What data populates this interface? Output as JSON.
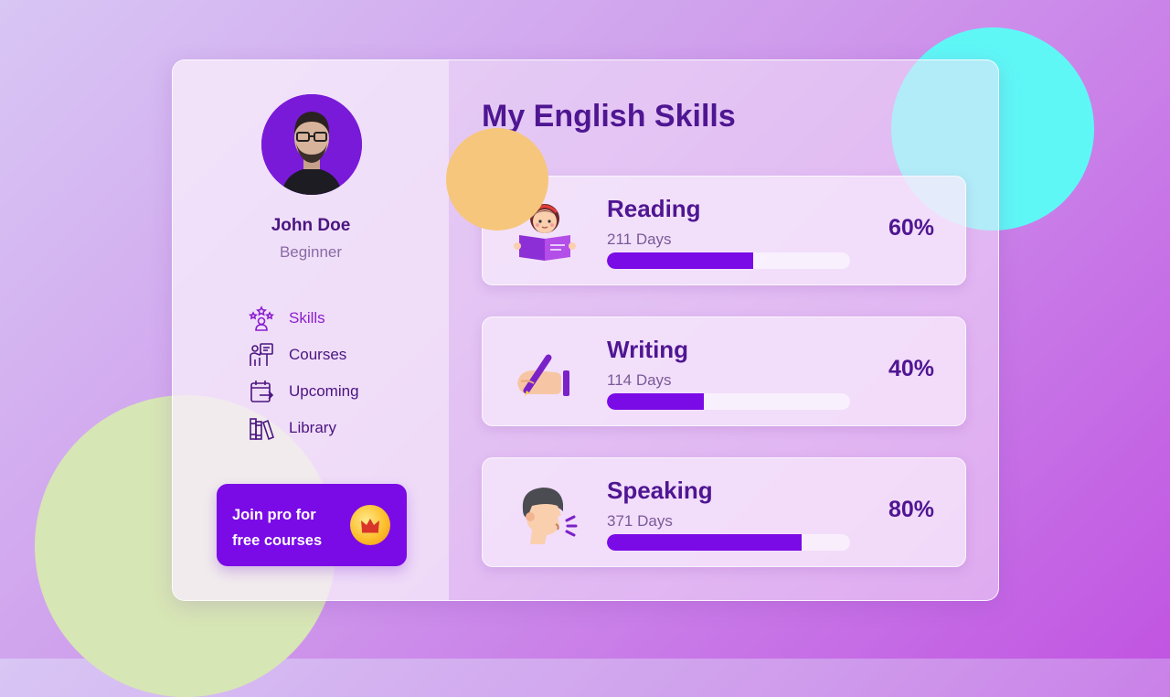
{
  "profile": {
    "name": "John Doe",
    "level": "Beginner"
  },
  "nav": [
    {
      "label": "Skills",
      "icon": "skills-icon",
      "active": true
    },
    {
      "label": "Courses",
      "icon": "courses-icon",
      "active": false
    },
    {
      "label": "Upcoming",
      "icon": "upcoming-icon",
      "active": false
    },
    {
      "label": "Library",
      "icon": "library-icon",
      "active": false
    }
  ],
  "promo": {
    "line1": "Join pro for",
    "line2": "free courses",
    "icon": "crown-icon"
  },
  "main": {
    "title": "My English Skills"
  },
  "skills": [
    {
      "name": "Reading",
      "days": "211 Days",
      "percent_text": "60%",
      "progress": 0.6,
      "icon": "reading-icon"
    },
    {
      "name": "Writing",
      "days": "114 Days",
      "percent_text": "40%",
      "progress": 0.4,
      "icon": "writing-icon"
    },
    {
      "name": "Speaking",
      "days": "371 Days",
      "percent_text": "80%",
      "progress": 0.8,
      "icon": "speaking-icon"
    }
  ],
  "colors": {
    "accent": "#7a0ae6",
    "title": "#4f1692",
    "active_nav": "#8b1fd0",
    "blob_cyan": "#5ff7f6",
    "blob_green": "#d7e6b5",
    "blob_orange": "#f6c67c"
  }
}
